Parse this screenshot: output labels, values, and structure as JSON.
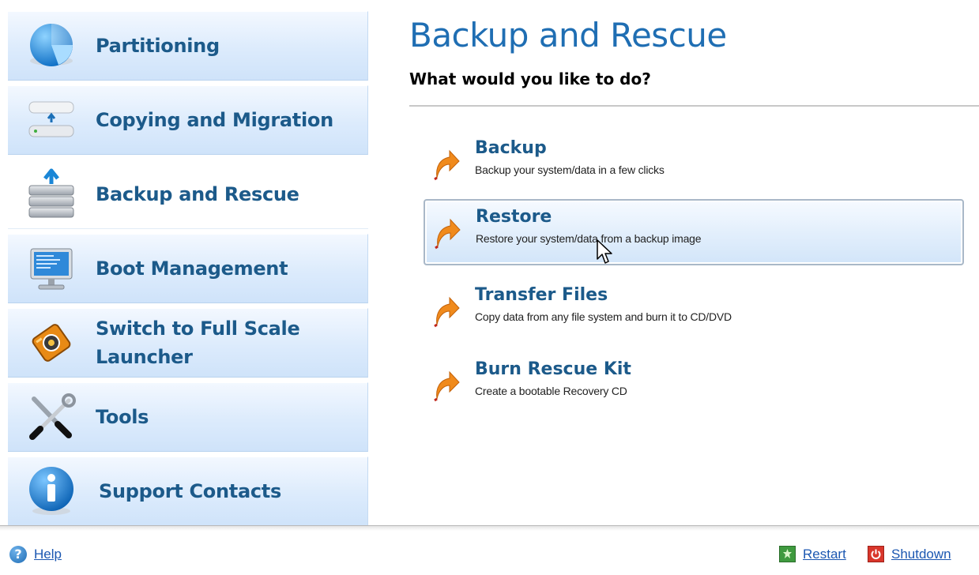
{
  "sidebar": {
    "items": [
      {
        "label": "Partitioning",
        "icon": "pie-chart-icon"
      },
      {
        "label": "Copying and Migration",
        "icon": "drive-copy-icon"
      },
      {
        "label": "Backup and Rescue",
        "icon": "backup-stack-icon",
        "active": true
      },
      {
        "label": "Boot Management",
        "icon": "monitor-icon"
      },
      {
        "label": "Switch to Full Scale Launcher",
        "icon": "launcher-tag-icon"
      },
      {
        "label": "Tools",
        "icon": "tools-icon"
      },
      {
        "label": "Support Contacts",
        "icon": "info-icon"
      }
    ]
  },
  "main": {
    "title": "Backup and Rescue",
    "subtitle": "What would you like to do?",
    "actions": [
      {
        "title": "Backup",
        "description": "Backup your system/data in a few clicks",
        "icon": "orange-arrow-icon"
      },
      {
        "title": "Restore",
        "description": "Restore your system/data from a backup image",
        "icon": "orange-arrow-icon",
        "hovered": true
      },
      {
        "title": "Transfer Files",
        "description": "Copy data from any file system and burn it to CD/DVD",
        "icon": "orange-arrow-icon"
      },
      {
        "title": "Burn Rescue Kit",
        "description": "Create a bootable Recovery CD",
        "icon": "orange-arrow-icon"
      }
    ]
  },
  "footer": {
    "help_label": "Help",
    "restart_label": "Restart",
    "shutdown_label": "Shutdown"
  },
  "colors": {
    "accent": "#1f6eb3",
    "nav_text": "#1c5a8a",
    "link": "#1b57b1",
    "action_arrow": "#f08a1c"
  }
}
